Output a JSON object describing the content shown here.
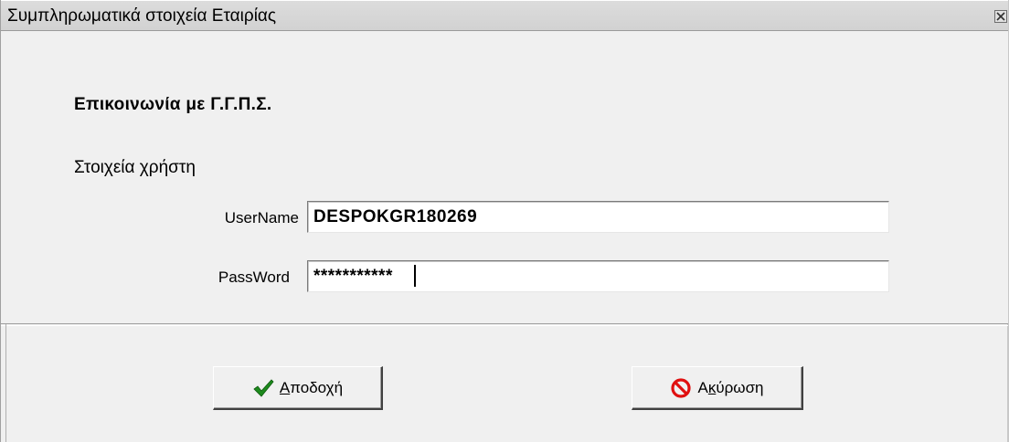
{
  "window": {
    "title": "Συμπληρωματικά στοιχεία Εταιρίας",
    "close_icon": "close-icon"
  },
  "form": {
    "heading": "Επικοινωνία  με Γ.Γ.Π.Σ.",
    "section_label": "Στοιχεία χρήστη",
    "username": {
      "label": "UserName",
      "value": "DESPOKGR180269"
    },
    "password": {
      "label": "PassWord",
      "value": "***********"
    }
  },
  "buttons": {
    "accept": {
      "label_first": "Α",
      "label_rest": "ποδοχή",
      "icon": "checkmark-icon",
      "icon_color": "#1d8a1d"
    },
    "cancel": {
      "label_first": "Α",
      "label_underlined": "κ",
      "label_rest": "ύρωση",
      "icon": "prohibited-icon",
      "icon_color": "#e01010"
    }
  }
}
